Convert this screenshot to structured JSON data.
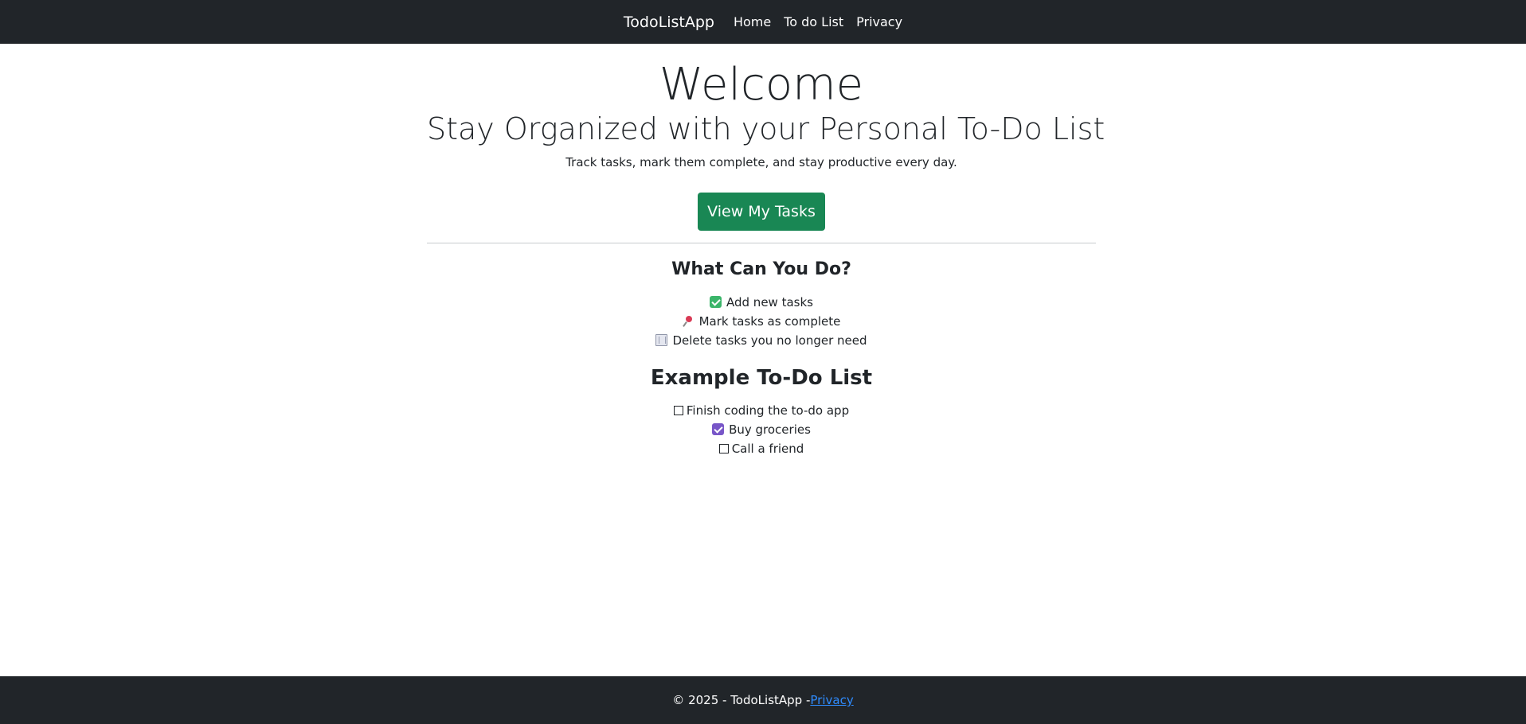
{
  "navbar": {
    "brand": "TodoListApp",
    "links": [
      {
        "label": "Home"
      },
      {
        "label": "To do List"
      },
      {
        "label": "Privacy"
      }
    ]
  },
  "hero": {
    "title": "Welcome",
    "subtitle": "Stay Organized with your Personal To-Do List",
    "tagline": "Track tasks, mark them complete, and stay productive every day.",
    "cta_label": "View My Tasks"
  },
  "features": {
    "heading": "What Can You Do?",
    "items": [
      {
        "icon": "check-mark-button-icon",
        "label": "Add new tasks"
      },
      {
        "icon": "pushpin-icon",
        "label": "Mark tasks as complete"
      },
      {
        "icon": "wastebasket-icon",
        "label": "Delete tasks you no longer need"
      }
    ]
  },
  "example": {
    "heading": "Example To-Do List",
    "items": [
      {
        "checked": false,
        "label": "Finish coding the to-do app"
      },
      {
        "checked": true,
        "label": "Buy groceries"
      },
      {
        "checked": false,
        "label": "Call a friend"
      }
    ]
  },
  "footer": {
    "text": "© 2025 - TodoListApp -",
    "link_label": "Privacy"
  },
  "colors": {
    "navbar_bg": "#212529",
    "cta_bg": "#198754",
    "footer_link": "#2f8cff",
    "checked_box": "#7856c8"
  }
}
